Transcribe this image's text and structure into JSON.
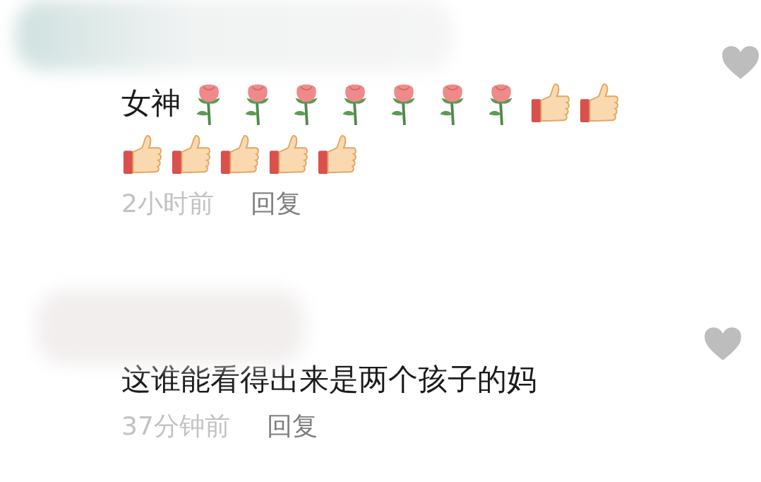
{
  "comments": [
    {
      "text": "女神",
      "emojis": [
        {
          "kind": "rose"
        },
        {
          "kind": "rose"
        },
        {
          "kind": "rose"
        },
        {
          "kind": "rose"
        },
        {
          "kind": "rose"
        },
        {
          "kind": "rose"
        },
        {
          "kind": "rose"
        },
        {
          "kind": "thumbs"
        },
        {
          "kind": "thumbs"
        },
        {
          "kind": "thumbs"
        },
        {
          "kind": "thumbs"
        },
        {
          "kind": "thumbs"
        },
        {
          "kind": "thumbs"
        },
        {
          "kind": "thumbs"
        }
      ],
      "time": "2小时前",
      "reply": "回复",
      "liked": false
    },
    {
      "text": "这谁能看得出来是两个孩子的妈",
      "time": "37分钟前",
      "reply": "回复",
      "liked": false
    }
  ]
}
